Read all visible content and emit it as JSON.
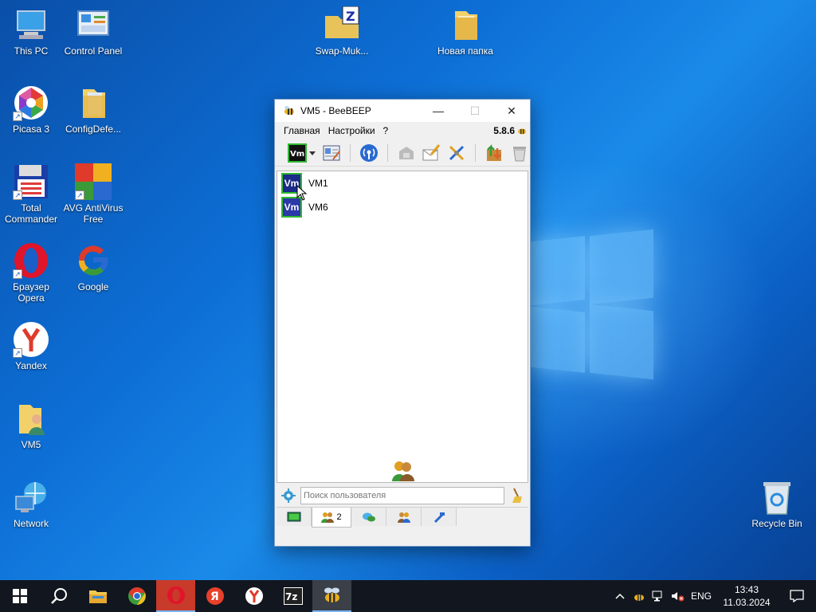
{
  "desktop": {
    "icons": [
      {
        "label": "This PC"
      },
      {
        "label": "Control Panel"
      },
      {
        "label": "Swap-Muk..."
      },
      {
        "label": "Новая папка"
      },
      {
        "label": "Picasa 3"
      },
      {
        "label": "ConfigDefe..."
      },
      {
        "label": "Total Commander"
      },
      {
        "label": "AVG AntiVirus Free"
      },
      {
        "label": "Браузер Opera"
      },
      {
        "label": "Google"
      },
      {
        "label": "Yandex"
      },
      {
        "label": "VM5"
      },
      {
        "label": "Network"
      },
      {
        "label": "Recycle Bin"
      }
    ]
  },
  "window": {
    "title": "VM5 - BeeBEEP",
    "minimize": "—",
    "maximize": "☐",
    "close": "✕",
    "menu": [
      "Главная",
      "Настройки",
      "?"
    ],
    "version": "5.8.6",
    "users": [
      {
        "avatar": "Vm",
        "name": "VM1"
      },
      {
        "avatar": "Vm",
        "name": "VM6"
      }
    ],
    "search_placeholder": "Поиск пользователя",
    "tabs": {
      "users_count": "2"
    }
  },
  "taskbar": {
    "lang": "ENG",
    "time": "13:43",
    "date": "11.03.2024"
  },
  "colors": {
    "accent": "#0d6fd6",
    "taskbar": "#12161f",
    "avatar_border": "#2fb82f",
    "avatar_bg": "#2b38a8"
  }
}
